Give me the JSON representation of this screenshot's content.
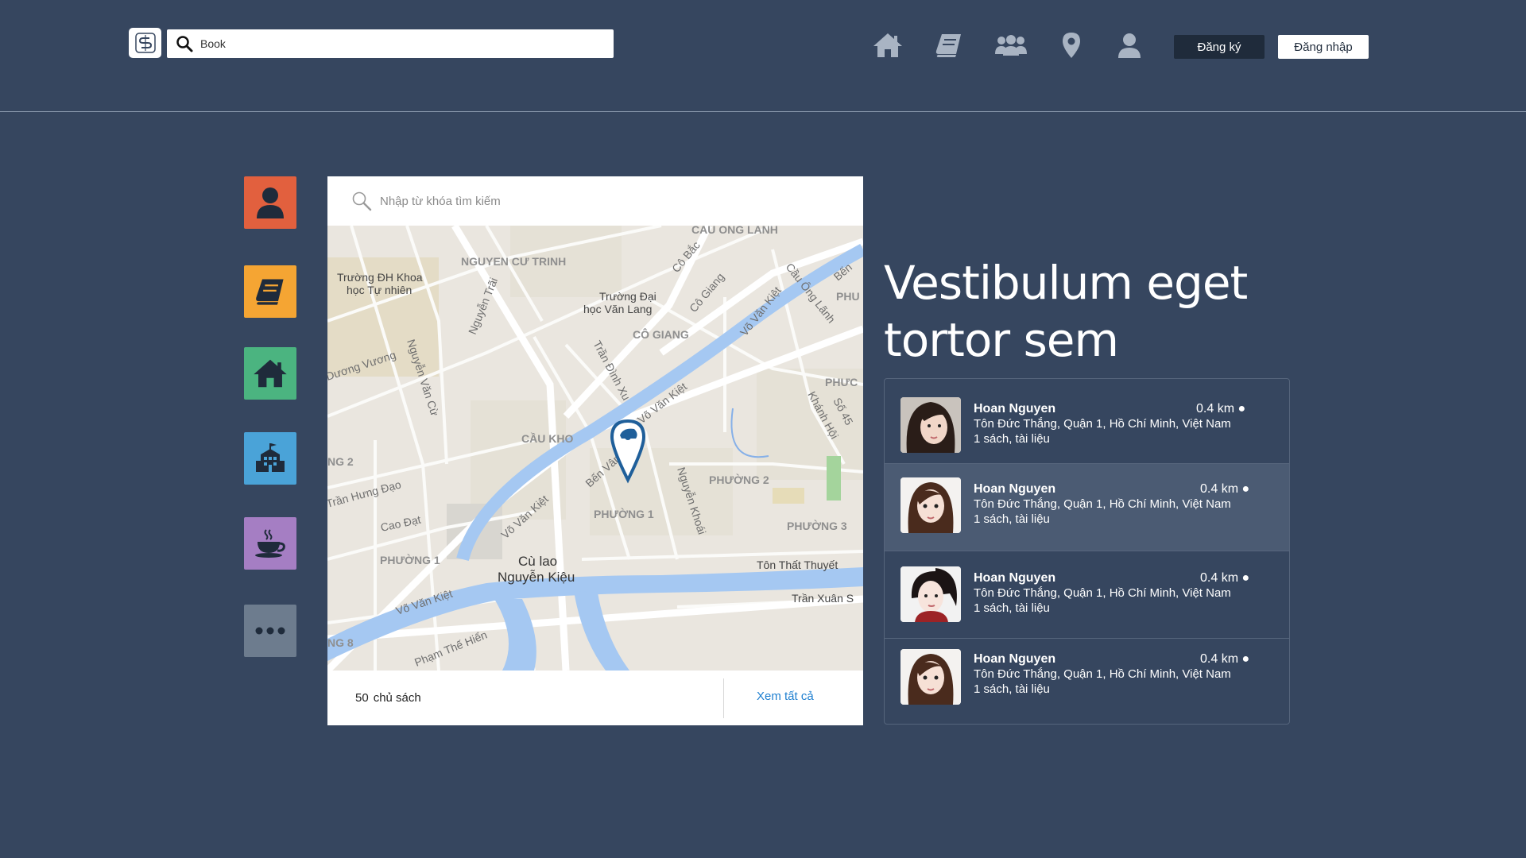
{
  "header": {
    "search_value": "Book",
    "nav_icons": [
      "home-icon",
      "book-icon",
      "users-icon",
      "location-pin-icon",
      "user-icon"
    ],
    "register_label": "Đăng ký",
    "login_label": "Đăng nhập"
  },
  "categories": [
    {
      "icon": "user-icon",
      "color": "#e2603e"
    },
    {
      "icon": "book-icon",
      "color": "#f5a533"
    },
    {
      "icon": "home-icon",
      "color": "#4bb480"
    },
    {
      "icon": "building-icon",
      "color": "#4aa3d8"
    },
    {
      "icon": "coffee-cup-icon",
      "color": "#a57ec3"
    },
    {
      "icon": "more-icon",
      "color": "#6d7c8e"
    }
  ],
  "map": {
    "search_placeholder": "Nhập từ khóa tìm kiếm",
    "labels": {
      "cau_ong_lanh": "CAU ONG LANH",
      "nguyen_cu_trinh": "NGUYEN CƯ TRINH",
      "truong_dh_khoa": "Trường ĐH Khoa",
      "hoc_tu_nhien": "học Tự nhiên",
      "truong_dai": "Trường Đại",
      "hoc_van_lang": "học Văn Lang",
      "co_bac": "Cô Bắc",
      "co_giang_st": "Cô Giang",
      "co_giang": "CÔ GIANG",
      "vo_van_kiet_1": "Võ Văn Kiệt",
      "cau_ong_lanh_st": "Cầu Ông Lãnh",
      "nguyen_trai": "Nguyễn Trãi",
      "duong_vuong": "Dương Vương",
      "nguyen_van_cu": "Nguyễn Văn Cừ",
      "tran_dinh_xu": "Trần Đình Xu",
      "cau_kho": "CẦU KHO",
      "vo_van_kiet_2": "Võ Văn Kiệt",
      "ben_van_don": "Bến Vân Đồn",
      "khanh_hoi": "Khánh Hội",
      "so_45": "Số 45",
      "phuong_2": "PHƯỜNG 2",
      "tran_hung_dao": "Trần Hưng Đạo",
      "cao_dat": "Cao Đạt",
      "vo_van_kiet_3": "Võ Văn Kiệt",
      "phuong_1": "PHƯỜNG 1",
      "nguyen_khoai": "Nguyễn Khoái",
      "phuong_3": "PHƯỜNG 3",
      "phuong_1b": "PHƯỜNG 1",
      "cu_lao": "Cù lao",
      "nguyen_kieu": "Nguyễn Kiệu",
      "ton_that_thuyet": "Tôn Thất Thuyết",
      "vo_van_kiet_4": "Võ Văn Kiệt",
      "tran_xuan": "Trần Xuân S",
      "pham_the_hien": "Phạm Thế Hiển",
      "ng_2": "NG 2",
      "ng_8": "NG 8",
      "phu": "PHU",
      "phuc": "PHƯC",
      "ben": "Bến"
    },
    "owner_count": "50",
    "owner_label": "chủ sách",
    "see_all_label": "Xem tất cả"
  },
  "headline": "Vestibulum eget tortor sem",
  "users": [
    {
      "name": "Hoan Nguyen",
      "distance": "0.4 km",
      "address": "Tôn Đức Thắng, Quận 1, Hồ Chí Minh, Việt Nam",
      "books": "1 sách, tài liệu",
      "selected": false
    },
    {
      "name": "Hoan Nguyen",
      "distance": "0.4 km",
      "address": "Tôn Đức Thắng, Quận 1, Hồ Chí Minh, Việt Nam",
      "books": "1 sách, tài liệu",
      "selected": true
    },
    {
      "name": "Hoan Nguyen",
      "distance": "0.4 km",
      "address": "Tôn Đức Thắng, Quận 1, Hồ Chí Minh, Việt Nam",
      "books": "1 sách, tài liệu",
      "selected": false
    },
    {
      "name": "Hoan Nguyen",
      "distance": "0.4 km",
      "address": "Tôn Đức Thắng, Quận 1, Hồ Chí Minh, Việt Nam",
      "books": "1 sách, tài liệu",
      "selected": false
    }
  ]
}
